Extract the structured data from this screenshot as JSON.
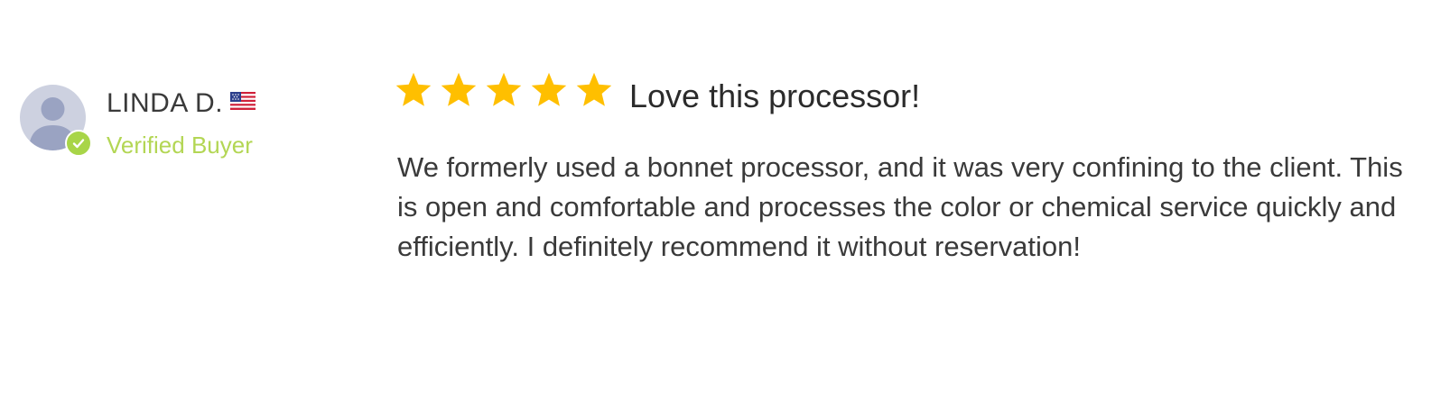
{
  "review": {
    "author": "LINDA D.",
    "country_flag": "us-flag-icon",
    "verified_label": "Verified Buyer",
    "rating": 5,
    "rating_max": 5,
    "title": "Love this processor!",
    "body_lines": [
      "We formerly used a bonnet processor, and it was very confining to the client. This",
      "is open and comfortable and processes the color or chemical service quickly and",
      "efficiently. I definitely recommend it without reservation!"
    ]
  },
  "colors": {
    "star": "#ffbf00",
    "verified": "#a8d548",
    "avatar_bg": "#cdd1e0",
    "avatar_fg": "#9aa3c2"
  }
}
